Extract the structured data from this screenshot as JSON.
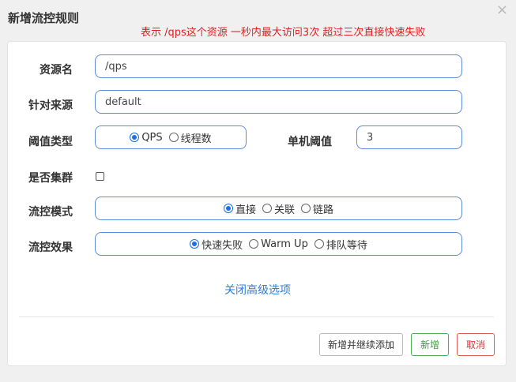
{
  "dialog": {
    "title": "新增流控规则",
    "note": "表示 /qps这个资源  一秒内最大访问3次  超过三次直接快速失败",
    "close_glyph": "×"
  },
  "form": {
    "resource": {
      "label": "资源名",
      "value": "/qps"
    },
    "origin": {
      "label": "针对来源",
      "value": "default"
    },
    "threshold_type": {
      "label": "阈值类型",
      "options": [
        "QPS",
        "线程数"
      ],
      "selected": "QPS"
    },
    "single_threshold": {
      "label": "单机阈值",
      "value": "3"
    },
    "cluster": {
      "label": "是否集群",
      "checked": false
    },
    "flow_mode": {
      "label": "流控模式",
      "options": [
        "直接",
        "关联",
        "链路"
      ],
      "selected": "直接"
    },
    "flow_effect": {
      "label": "流控效果",
      "options": [
        "快速失败",
        "Warm Up",
        "排队等待"
      ],
      "selected": "快速失败"
    }
  },
  "advanced_toggle": "关闭高级选项",
  "buttons": {
    "add_continue": "新增并继续添加",
    "add": "新增",
    "cancel": "取消"
  },
  "colors": {
    "note": "#e02020",
    "link": "#2d7ed8",
    "radio_selected": "#1a6fe8",
    "add_button": "#3a9d3e",
    "cancel_button": "#d9373a"
  }
}
